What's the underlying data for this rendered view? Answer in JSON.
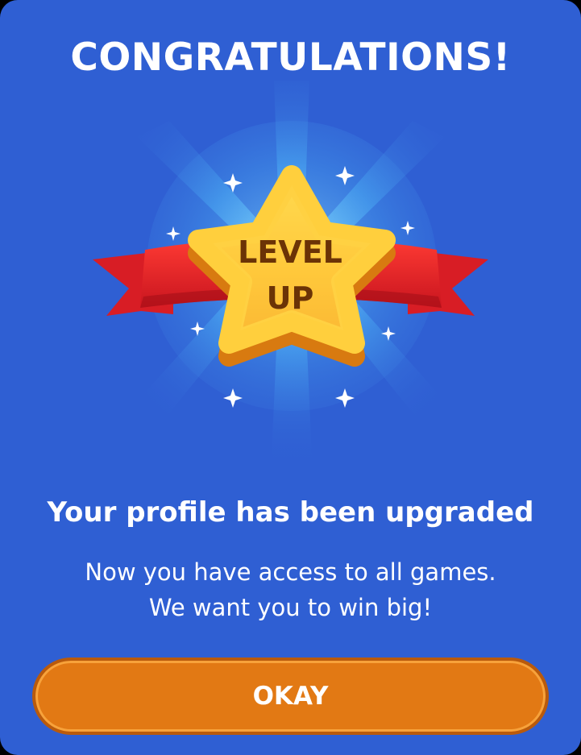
{
  "dialog": {
    "title": "CONGRATULATIONS!",
    "badge": {
      "line1": "LEVEL",
      "line2": "UP"
    },
    "headline": "Your profile has been upgraded",
    "message_line1": "Now you have access to all games.",
    "message_line2": "We want you to win big!",
    "okay_label": "OKAY"
  },
  "colors": {
    "background": "#2f5fd3",
    "accent_button": "#e27914",
    "star": "#ffc93a",
    "ribbon": "#e8282a",
    "badge_text": "#6b3306"
  },
  "icons": [
    "sparkle-icon",
    "star-badge-icon",
    "ribbon-icon"
  ]
}
